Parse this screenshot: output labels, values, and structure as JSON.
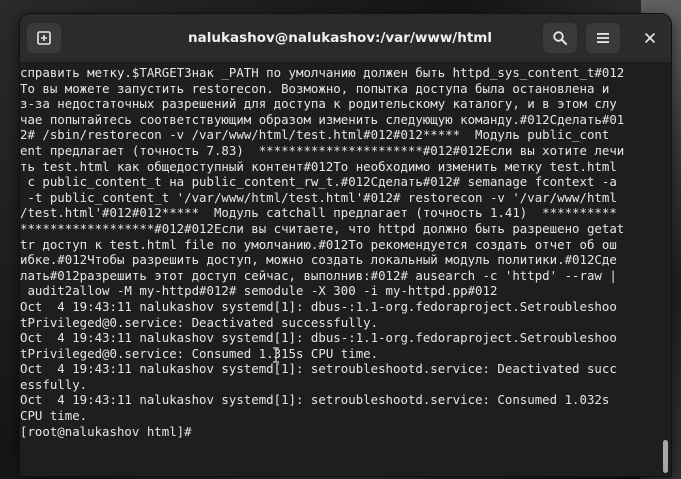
{
  "window": {
    "title": "nalukashov@nalukashov:/var/www/html"
  },
  "titlebar": {
    "new_tab_icon": "new-tab-icon",
    "search_icon": "search-icon",
    "menu_icon": "hamburger-menu-icon",
    "close_icon": "close-icon"
  },
  "terminal": {
    "lines": [
      "справить метку.$TARGETЗнак _PATH по умолчанию должен быть httpd_sys_content_t#012",
      "То вы можете запустить restorecon. Возможно, попытка доступа была остановлена и",
      "з-за недостаточных разрешений для доступа к родительскому каталогу, и в этом слу",
      "чае попытайтесь соответствующим образом изменить следующую команду.#012Сделать#01",
      "2# /sbin/restorecon -v /var/www/html/test.html#012#012*****  Модуль public_cont",
      "ent предлагает (точность 7.83)  **********************#012#012Если вы хотите лечи",
      "ть test.html как общедоступный контент#012То необходимо изменить метку test.html",
      " с public_content_t на public_content_rw_t.#012Сделать#012# semanage fcontext -a",
      " -t public_content_t '/var/www/html/test.html'#012# restorecon -v '/var/www/html",
      "/test.html'#012#012*****  Модуль catchall предлагает (точность 1.41)  **********",
      "******************#012#012Если вы считаете, что httpd должно быть разрешено getat",
      "tr доступ к test.html file по умолчанию.#012То рекомендуется создать отчет об ош",
      "ибке.#012Чтобы разрешить доступ, можно создать локальный модуль политики.#012Сде",
      "лать#012разрешить этот доступ сейчас, выполнив:#012# ausearch -c 'httpd' --raw |",
      " audit2allow -M my-httpd#012# semodule -X 300 -i my-httpd.pp#012",
      "Oct  4 19:43:11 nalukashov systemd[1]: dbus-:1.1-org.fedoraproject.Setroubleshoo",
      "tPrivileged@0.service: Deactivated successfully.",
      "Oct  4 19:43:11 nalukashov systemd[1]: dbus-:1.1-org.fedoraproject.Setroubleshoo",
      "tPrivileged@0.service: Consumed 1.315s CPU time.",
      "Oct  4 19:43:11 nalukashov systemd[1]: setroubleshootd.service: Deactivated succ",
      "essfully.",
      "Oct  4 19:43:11 nalukashov systemd[1]: setroubleshootd.service: Consumed 1.032s",
      "CPU time.",
      "[root@nalukashov html]# "
    ]
  },
  "scroll": {
    "position_fraction": 1.0
  },
  "colors": {
    "terminal_bg": "#1e1e1e",
    "terminal_fg": "#e6e6e6",
    "titlebar_bg": "#2b2b2b"
  }
}
